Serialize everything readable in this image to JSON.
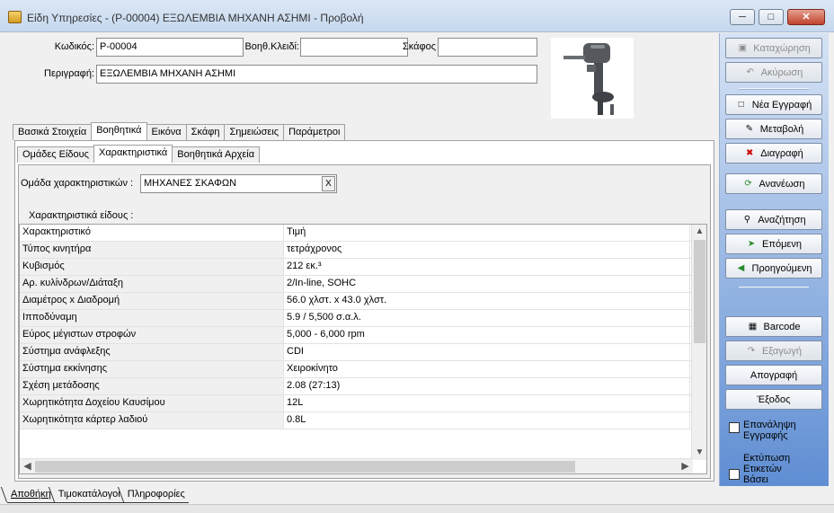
{
  "window": {
    "title": "Είδη Υπηρεσίες - (Ρ-00004) ΕΞΩΛΕΜΒΙΑ ΜΗΧΑΝΗ ΑΣΗΜΙ -  Προβολή",
    "buttons": [
      "minimize-icon",
      "maximize-icon",
      "close-icon"
    ]
  },
  "header": {
    "code_label": "Κωδικός:",
    "code_value": "Ρ-00004",
    "aux_key_label": "Βοηθ.Κλειδί:",
    "aux_key_value": "",
    "vessel_label": "Σκάφος",
    "vessel_value": "",
    "description_label": "Περιγραφή:",
    "description_value": "ΕΞΩΛΕΜΒΙΑ ΜΗΧΑΝΗ ΑΣΗΜΙ"
  },
  "tabs": [
    {
      "label": "Βασικά Στοιχεία"
    },
    {
      "label": "Βοηθητικά",
      "active": true
    },
    {
      "label": "Εικόνα"
    },
    {
      "label": "Σκάφη"
    },
    {
      "label": "Σημειώσεις"
    },
    {
      "label": "Παράμετροι"
    }
  ],
  "subtabs": [
    {
      "label": "Ομάδες Είδους"
    },
    {
      "label": "Χαρακτηριστικά",
      "active": true
    },
    {
      "label": "Βοηθητικά Αρχεία"
    }
  ],
  "characteristics": {
    "group_label": "Ομάδα χαρακτηριστικών :",
    "group_value": "ΜΗΧΑΝΕΣ ΣΚΑΦΩΝ",
    "clear_label": "X",
    "list_label": "Χαρακτηριστικά είδους :",
    "columns": [
      "Χαρακτηριστικό",
      "Τιμή"
    ],
    "rows": [
      [
        "Τύπος κινητήρα",
        "τετράχρονος"
      ],
      [
        "Κυβισμός",
        "212 εκ.³"
      ],
      [
        "Αρ. κυλίνδρων/Διάταξη",
        "2/In-line, SOHC"
      ],
      [
        "Διαμέτρος x Διαδρομή",
        "56.0 χλστ. x 43.0 χλστ."
      ],
      [
        "Ιπποδύναμη",
        "5.9 / 5,500 σ.α.λ."
      ],
      [
        "Εύρος μέγιστων στροφών",
        "5,000 - 6,000 rpm"
      ],
      [
        "Σύστημα ανάφλεξης",
        "CDI"
      ],
      [
        "Σύστημα εκκίνησης",
        "Χειροκίνητο"
      ],
      [
        "Σχέση μετάδοσης",
        "2.08 (27:13)"
      ],
      [
        "Χωρητικότητα Δοχείου Καυσίμου",
        "12L"
      ],
      [
        "Χωρητικότητα κάρτερ λαδιού",
        "0.8L"
      ]
    ]
  },
  "sidebar": {
    "save": "Καταχώρηση",
    "cancel": "Ακύρωση",
    "new": "Νέα Εγγραφή",
    "edit": "Μεταβολή",
    "delete": "Διαγραφή",
    "refresh": "Ανανέωση",
    "search": "Αναζήτηση",
    "next": "Επόμενη",
    "previous": "Προηγούμενη",
    "barcode": "Barcode",
    "export": "Εξαγωγή",
    "inventory": "Απογραφή",
    "exit": "Έξοδος",
    "repeat_label": "Επανάληψη Εγγραφής",
    "print_label": "Εκτύπωση Ετικετών Βάσει"
  },
  "bottom_tabs": [
    {
      "label": "Αποθήκη",
      "active": true
    },
    {
      "label": "Τιμοκατάλογοι"
    },
    {
      "label": "Πληροφορίες"
    }
  ]
}
